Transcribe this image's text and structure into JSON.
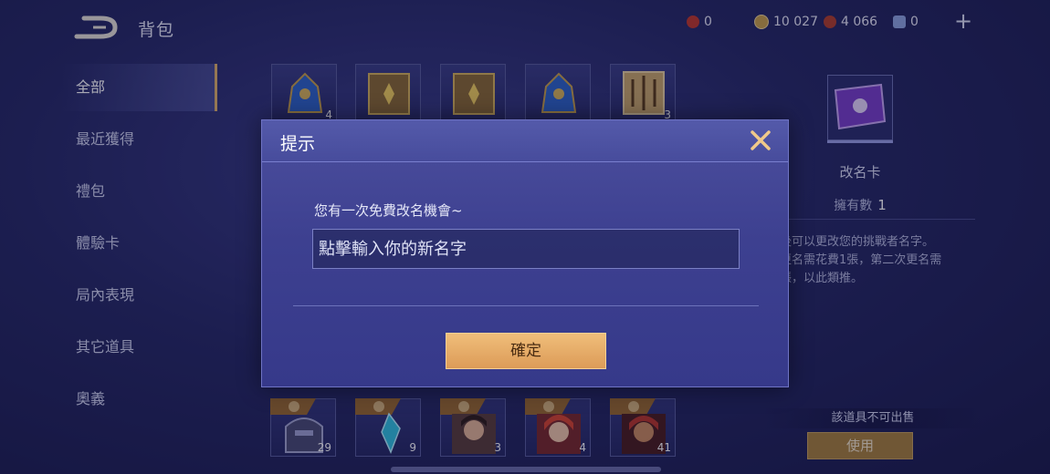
{
  "header": {
    "title": "背包",
    "currencies": [
      {
        "name": "token",
        "value": "0",
        "color": "#c0392b"
      },
      {
        "name": "coin",
        "value": "10 027",
        "color": "#c9a24a"
      },
      {
        "name": "gem",
        "value": "4 066",
        "color": "#b3402c"
      },
      {
        "name": "voucher",
        "value": "0",
        "color": "#8fa6e0"
      }
    ],
    "add_label": "+"
  },
  "sidebar": {
    "items": [
      {
        "label": "全部",
        "active": true
      },
      {
        "label": "最近獲得",
        "active": false
      },
      {
        "label": "禮包",
        "active": false
      },
      {
        "label": "體驗卡",
        "active": false
      },
      {
        "label": "局內表現",
        "active": false
      },
      {
        "label": "其它道具",
        "active": false
      },
      {
        "label": "奧義",
        "active": false
      }
    ]
  },
  "grid_top": [
    {
      "icon": "blue-bag-icon",
      "count": "4"
    },
    {
      "icon": "gold-chest-icon",
      "count": ""
    },
    {
      "icon": "gold-chest-icon",
      "count": ""
    },
    {
      "icon": "blue-bag-icon",
      "count": ""
    },
    {
      "icon": "rune-box-icon",
      "count": "3"
    }
  ],
  "grid_bottom": [
    {
      "icon": "helmet-hero-icon",
      "count": "29"
    },
    {
      "icon": "crystal-icon",
      "count": "9"
    },
    {
      "icon": "hero-portrait-icon",
      "count": "3"
    },
    {
      "icon": "hero-portrait-icon",
      "count": "4"
    },
    {
      "icon": "hero-portrait-icon",
      "count": "41"
    }
  ],
  "detail": {
    "item_name": "改名卡",
    "own_label": "擁有數",
    "own_count": "1",
    "desc_lines": [
      "後可以更改您的挑戰者名字。",
      "更名需花費1張，第二次更名需",
      "張，以此類推。"
    ],
    "unsellable": "該道具不可出售",
    "use_label": "使用"
  },
  "dialog": {
    "title": "提示",
    "message": "您有一次免費改名機會~",
    "input_placeholder": "點擊輸入你的新名字",
    "input_value": "",
    "confirm_label": "確定"
  }
}
